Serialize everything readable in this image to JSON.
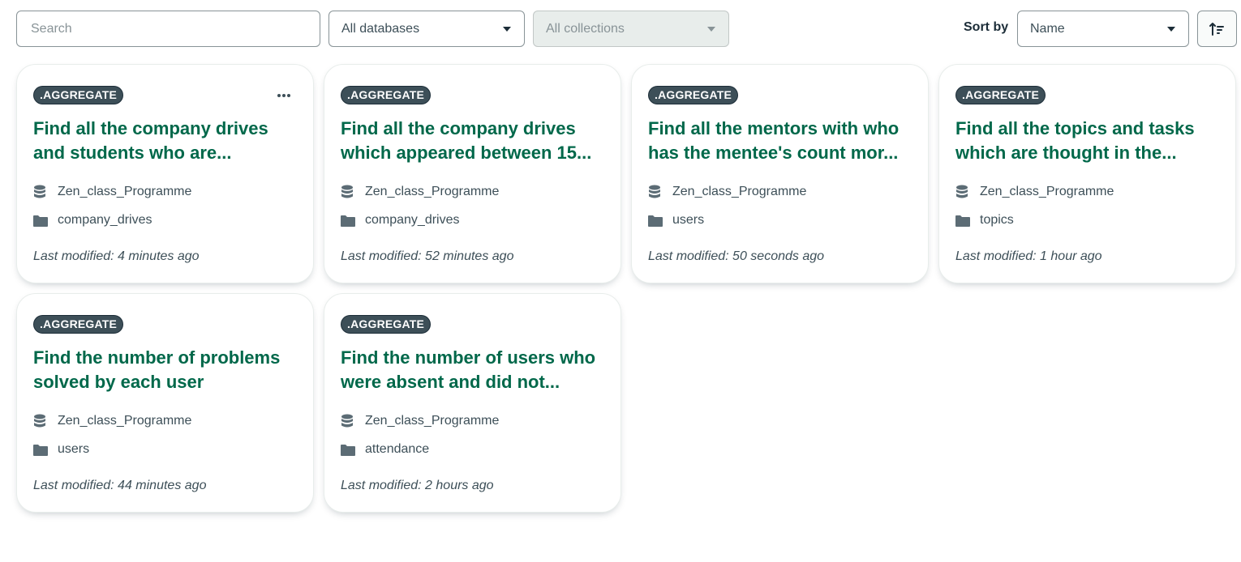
{
  "toolbar": {
    "search_placeholder": "Search",
    "database_select": "All databases",
    "collection_select": "All collections",
    "sort_label": "Sort by",
    "sort_value": "Name"
  },
  "cards": [
    {
      "badge": ".AGGREGATE",
      "title": "Find all the company drives\nand students who are...",
      "database": "Zen_class_Programme",
      "collection": "company_drives",
      "modified": "Last modified: 4 minutes ago"
    },
    {
      "badge": ".AGGREGATE",
      "title": "Find all the company drives\nwhich appeared between 15...",
      "database": "Zen_class_Programme",
      "collection": "company_drives",
      "modified": "Last modified: 52 minutes ago"
    },
    {
      "badge": ".AGGREGATE",
      "title": "Find all the mentors with who\nhas the mentee's count mor...",
      "database": "Zen_class_Programme",
      "collection": "users",
      "modified": "Last modified: 50 seconds ago"
    },
    {
      "badge": ".AGGREGATE",
      "title": "Find all the topics and tasks\nwhich are thought in the...",
      "database": "Zen_class_Programme",
      "collection": "topics",
      "modified": "Last modified: 1 hour ago"
    },
    {
      "badge": ".AGGREGATE",
      "title": "Find the number of problems\nsolved by each user",
      "database": "Zen_class_Programme",
      "collection": "users",
      "modified": "Last modified: 44 minutes ago"
    },
    {
      "badge": ".AGGREGATE",
      "title": "Find the number of users who\nwere absent and did not...",
      "database": "Zen_class_Programme",
      "collection": "attendance",
      "modified": "Last modified: 2 hours ago"
    }
  ],
  "icons": {
    "database": "database-icon",
    "collection": "folder-icon",
    "more": "ellipsis-icon",
    "sort_direction": "sort-ascending-icon"
  },
  "colors": {
    "title_green": "#00684a",
    "badge_bg": "#3d4f58"
  }
}
